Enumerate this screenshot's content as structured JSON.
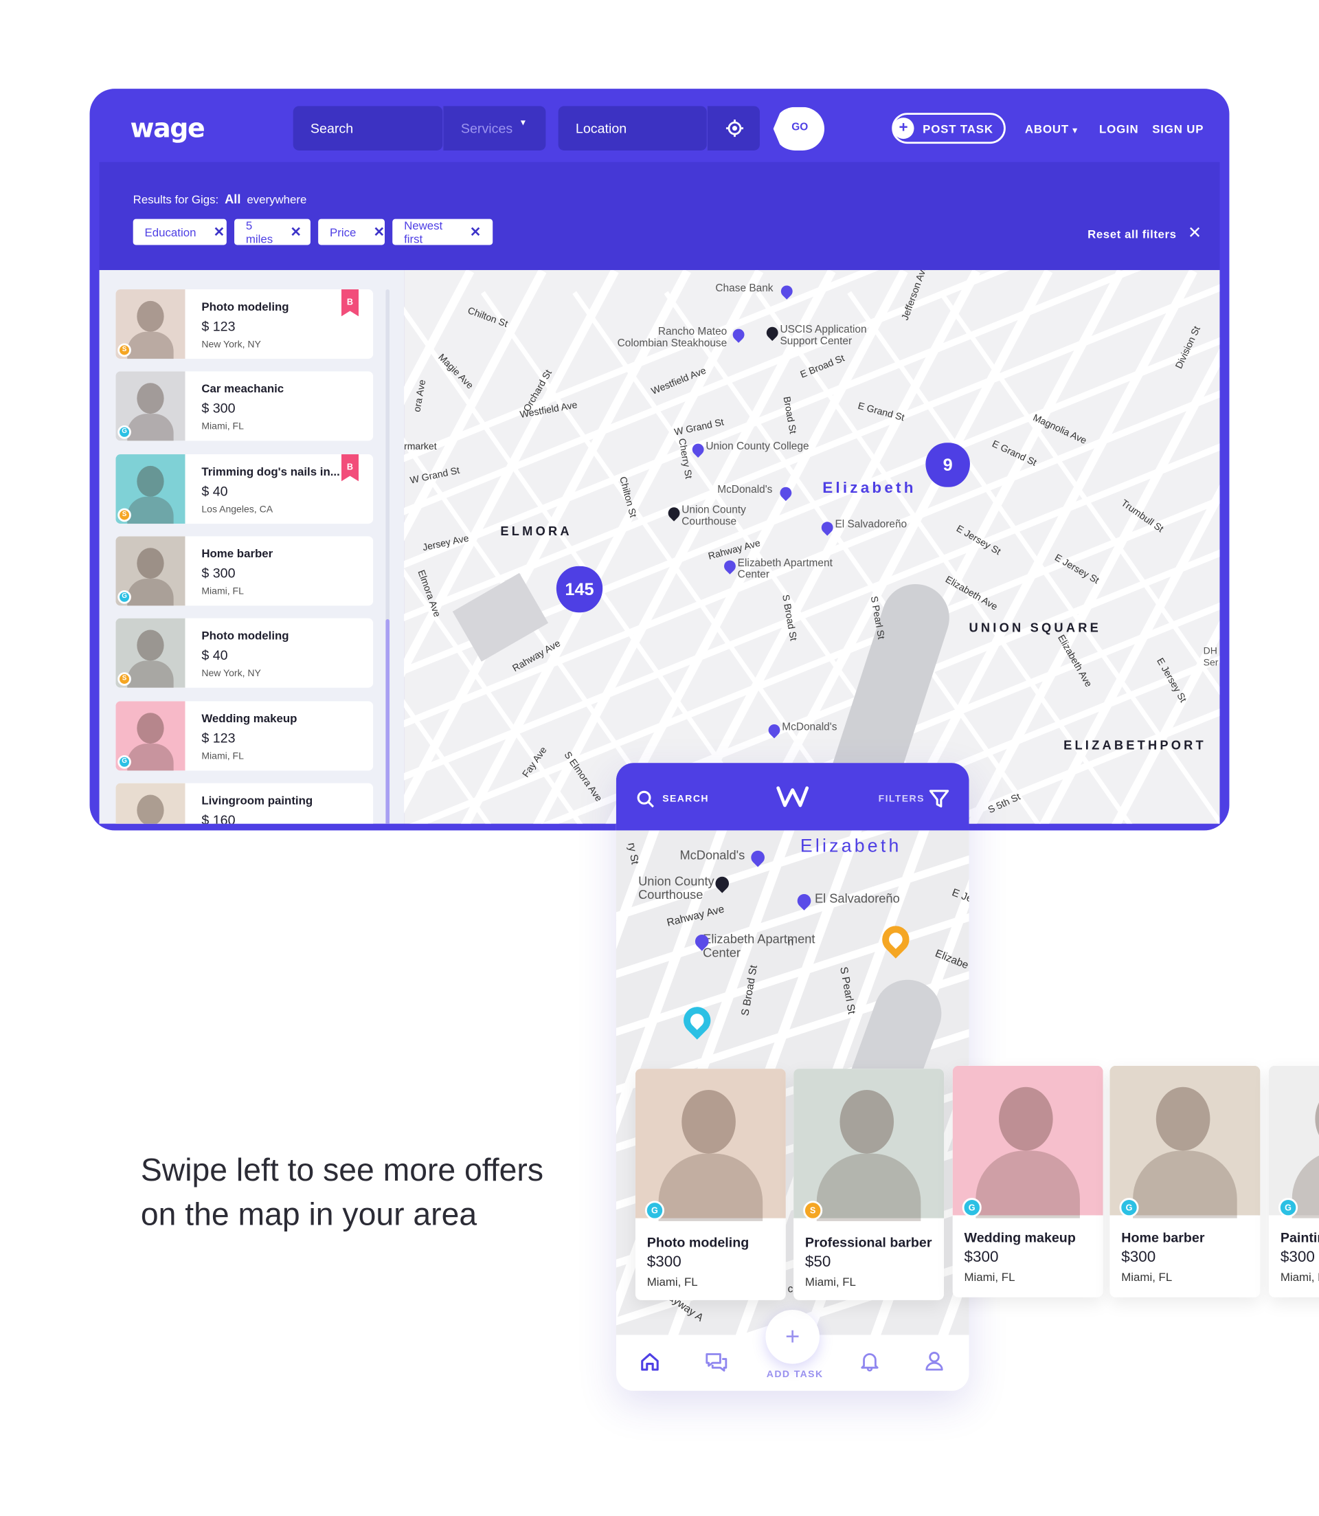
{
  "header": {
    "logo": "wage",
    "search_placeholder": "Search",
    "services_label": "Services",
    "location_label": "Location",
    "go_label": "GO",
    "post_task_label": "POST TASK",
    "about_label": "ABOUT",
    "login_label": "LOGIN",
    "signup_label": "SIGN UP"
  },
  "filters": {
    "results_prefix": "Results for Gigs:",
    "results_all": "All",
    "results_suffix": "everywhere",
    "chips": [
      "Education",
      "5 miles",
      "Price",
      "Newest first"
    ],
    "reset_label": "Reset all filters"
  },
  "list": [
    {
      "title": "Photo modeling",
      "price": "$ 123",
      "location": "New York, NY",
      "badge": "S",
      "badge_color": "#f5a623",
      "bookmark": "B",
      "thumb": "#e5d6ce"
    },
    {
      "title": "Car meachanic",
      "price": "$ 300",
      "location": "Miami, FL",
      "badge": "G",
      "badge_color": "#2bc0e4",
      "bookmark": "",
      "thumb": "#d9d9dc"
    },
    {
      "title": "Trimming dog's nails in...",
      "price": "$ 40",
      "location": "Los Angeles, CA",
      "badge": "S",
      "badge_color": "#f5a623",
      "bookmark": "B",
      "thumb": "#7fd1d6"
    },
    {
      "title": "Home barber",
      "price": "$ 300",
      "location": "Miami, FL",
      "badge": "G",
      "badge_color": "#2bc0e4",
      "bookmark": "",
      "thumb": "#cfc8c0"
    },
    {
      "title": "Photo modeling",
      "price": "$ 40",
      "location": "New York, NY",
      "badge": "S",
      "badge_color": "#f5a623",
      "bookmark": "",
      "thumb": "#cdd2cf"
    },
    {
      "title": "Wedding makeup",
      "price": "$ 123",
      "location": "Miami, FL",
      "badge": "G",
      "badge_color": "#2bc0e4",
      "bookmark": "",
      "thumb": "#f7b9c8"
    },
    {
      "title": "Livingroom painting",
      "price": "$ 160",
      "location": "",
      "badge": "",
      "badge_color": "",
      "bookmark": "",
      "thumb": "#e8dcd0"
    }
  ],
  "map": {
    "streets": [
      "Chilton St",
      "Magie Ave",
      "Orchard St",
      "Westfield Ave",
      "Westfield Ave",
      "W Grand St",
      "W Grand St",
      "Broad St",
      "E Broad St",
      "E Grand St",
      "E Grand St",
      "Jefferson Ave",
      "Division St",
      "Magnolia Ave",
      "Chilton St",
      "Cherry St",
      "Jersey Ave",
      "Elmora Ave",
      "Rahway Ave",
      "Rahway Ave",
      "E Jersey St",
      "E Jersey St",
      "Trumbull St",
      "Elizabeth Ave",
      "Elizabeth Ave",
      "S Broad St",
      "S Pearl St",
      "Fay Ave",
      "S Elmora Ave",
      "E Jersey St",
      "S 5th St",
      "ora Ave",
      "rmarket"
    ],
    "pois": [
      "Chase Bank",
      "Rancho Mateo Colombian Steakhouse",
      "USCIS Application Support Center",
      "Union County College",
      "McDonald's",
      "Union County Courthouse",
      "El Salvadoreño",
      "Elizabeth Apartment Center",
      "McDonald's"
    ],
    "areas": [
      "Elizabeth",
      "ELMORA",
      "UNION SQUARE",
      "ELIZABETHPORT"
    ],
    "clusters": [
      "9",
      "145"
    ],
    "edge_text": "DH Ser"
  },
  "mobile": {
    "search_label": "SEARCH",
    "filters_label": "FILTERS",
    "area": "Elizabeth",
    "pois": [
      "McDonald's",
      "Union County Courthouse",
      "El Salvadoreño",
      "Elizabeth Apartment Center"
    ],
    "streets": [
      "Rahway Ave",
      "S Broad St",
      "S Pearl St",
      "E Je",
      "Elizabe",
      "Bayway A",
      "ry St",
      "n",
      "c"
    ],
    "cards": [
      {
        "title": "Photo modeling",
        "price": "$300",
        "location": "Miami, FL",
        "badge": "G",
        "badge_color": "#2bc0e4",
        "img": "#e6d3c6"
      },
      {
        "title": "Professional barber",
        "price": "$50",
        "location": "Miami, FL",
        "badge": "S",
        "badge_color": "#f5a623",
        "img": "#d3dbd6"
      },
      {
        "title": "Wedding makeup",
        "price": "$300",
        "location": "Miami, FL",
        "badge": "G",
        "badge_color": "#2bc0e4",
        "img": "#f6bfcc"
      },
      {
        "title": "Home barber",
        "price": "$300",
        "location": "Miami, FL",
        "badge": "G",
        "badge_color": "#2bc0e4",
        "img": "#e2d8cc"
      },
      {
        "title": "Paintin",
        "price": "$300",
        "location": "Miami, F",
        "badge": "G",
        "badge_color": "#2bc0e4",
        "img": "#eeeeee"
      }
    ],
    "add_task_label": "ADD TASK",
    "tabs": [
      "home-icon",
      "chat-icon",
      "bell-icon",
      "user-icon"
    ]
  },
  "swipe_text": [
    "Swipe left to see more offers",
    "on the map in your area"
  ],
  "colors": {
    "brand": "#4e3fe4",
    "brand_dark": "#3c32c2",
    "bookmark": "#f24d7a",
    "badge_gold": "#f5a623",
    "badge_blue": "#2bc0e4"
  }
}
